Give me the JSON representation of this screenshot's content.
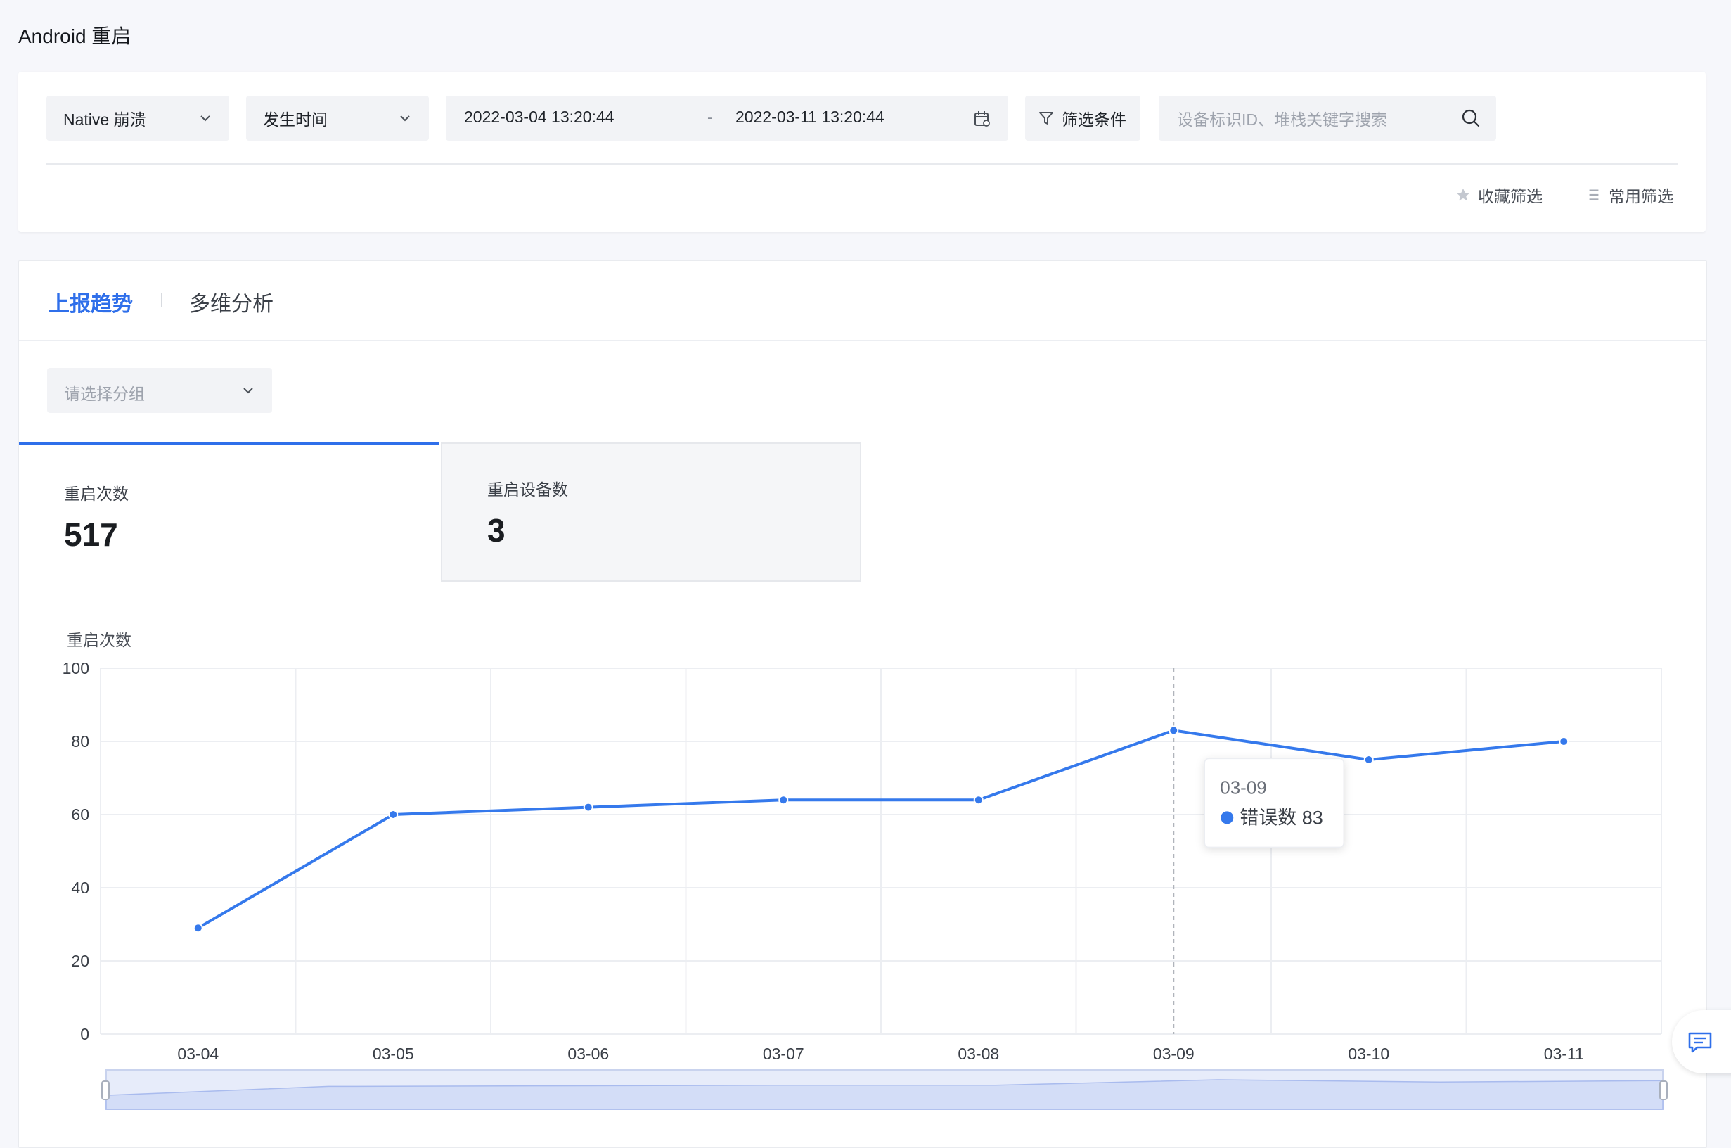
{
  "page": {
    "title": "Android 重启"
  },
  "filters": {
    "crash_type": "Native 崩溃",
    "time_field": "发生时间",
    "date_start": "2022-03-04 13:20:44",
    "date_sep": "-",
    "date_end": "2022-03-11 13:20:44",
    "filter_conditions": "筛选条件",
    "search_placeholder": "设备标识ID、堆栈关键字搜索",
    "save_filter": "收藏筛选",
    "common_filter": "常用筛选"
  },
  "tabs": [
    {
      "label": "上报趋势",
      "active": true
    },
    {
      "label": "多维分析",
      "active": false
    }
  ],
  "group_select": {
    "placeholder": "请选择分组"
  },
  "metrics": [
    {
      "label": "重启次数",
      "value": "517"
    },
    {
      "label": "重启设备数",
      "value": "3"
    }
  ],
  "colors": {
    "accent": "#2f6fea",
    "series": "#3579ec"
  },
  "chart_data": {
    "type": "line",
    "ylabel": "重启次数",
    "categories": [
      "03-04",
      "03-05",
      "03-06",
      "03-07",
      "03-08",
      "03-09",
      "03-10",
      "03-11"
    ],
    "series": [
      {
        "name": "错误数",
        "values": [
          29,
          60,
          62,
          64,
          64,
          83,
          75,
          80
        ]
      }
    ],
    "ylim": [
      0,
      100
    ],
    "yticks": [
      0,
      20,
      40,
      60,
      80,
      100
    ],
    "grid": true,
    "tooltip": {
      "category": "03-09",
      "series": "错误数",
      "value": "83"
    }
  }
}
